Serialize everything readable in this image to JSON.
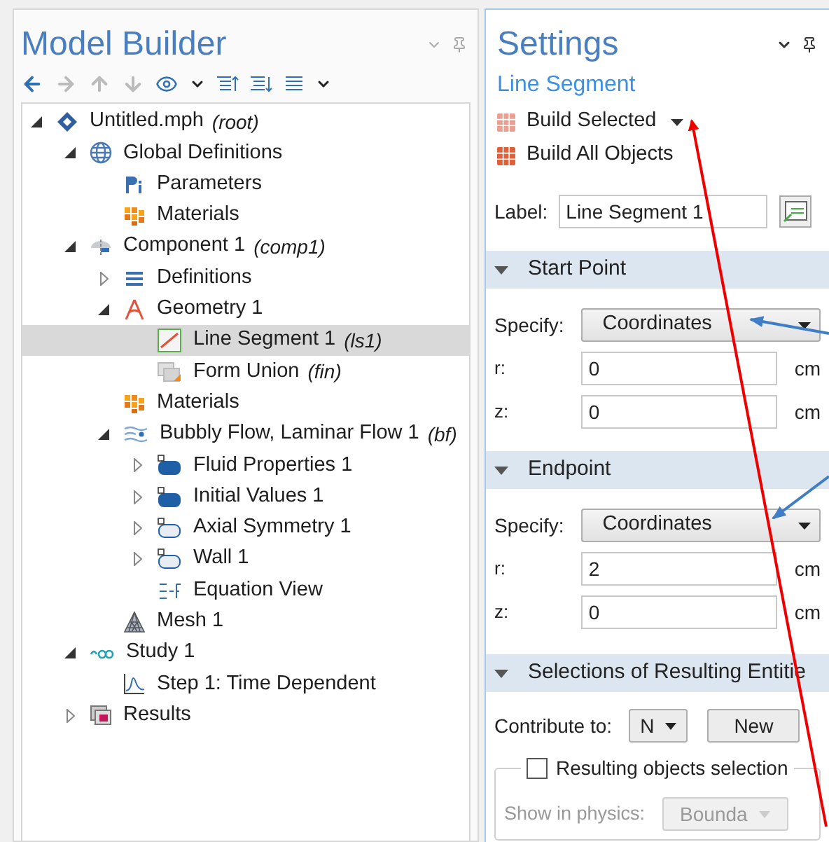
{
  "model_builder": {
    "title": "Model Builder",
    "tree": [
      {
        "kind": "root",
        "label": "Untitled.mph",
        "tag": "(root)",
        "expanded": true,
        "selected": false,
        "children": [
          {
            "kind": "globe",
            "label": "Global Definitions",
            "expanded": true,
            "selected": false,
            "children": [
              {
                "kind": "parameters",
                "label": "Parameters",
                "selected": false
              },
              {
                "kind": "materials",
                "label": "Materials",
                "selected": false
              }
            ]
          },
          {
            "kind": "component",
            "label": "Component 1",
            "tag": "(comp1)",
            "expanded": true,
            "selected": false,
            "children": [
              {
                "kind": "definitions",
                "label": "Definitions",
                "expanded": false,
                "selected": false
              },
              {
                "kind": "geometry",
                "label": "Geometry 1",
                "expanded": true,
                "selected": false,
                "children": [
                  {
                    "kind": "line",
                    "label": "Line Segment 1",
                    "tag": "(ls1)",
                    "selected": true
                  },
                  {
                    "kind": "union",
                    "label": "Form Union",
                    "tag": "(fin)",
                    "selected": false
                  }
                ]
              },
              {
                "kind": "materials",
                "label": "Materials",
                "selected": false
              },
              {
                "kind": "flow",
                "label": "Bubbly Flow, Laminar Flow 1",
                "tag": "(bf)",
                "expanded": true,
                "selected": false,
                "children": [
                  {
                    "kind": "domain",
                    "label": "Fluid Properties 1",
                    "expanded": false,
                    "selected": false
                  },
                  {
                    "kind": "domain",
                    "label": "Initial Values 1",
                    "expanded": false,
                    "selected": false
                  },
                  {
                    "kind": "boundary",
                    "label": "Axial Symmetry 1",
                    "expanded": false,
                    "selected": false
                  },
                  {
                    "kind": "boundary",
                    "label": "Wall 1",
                    "expanded": false,
                    "selected": false
                  },
                  {
                    "kind": "equation",
                    "label": "Equation View",
                    "selected": false
                  }
                ]
              },
              {
                "kind": "mesh",
                "label": "Mesh 1",
                "selected": false
              }
            ]
          },
          {
            "kind": "study",
            "label": "Study 1",
            "expanded": true,
            "selected": false,
            "children": [
              {
                "kind": "step",
                "label": "Step 1: Time Dependent",
                "selected": false
              }
            ]
          },
          {
            "kind": "results",
            "label": "Results",
            "expanded": false,
            "selected": false
          }
        ]
      }
    ]
  },
  "settings": {
    "title": "Settings",
    "subtitle": "Line Segment",
    "actions": [
      {
        "kind": "selected",
        "label": "Build Selected"
      },
      {
        "kind": "all",
        "label": "Build All Objects"
      }
    ],
    "label_field": {
      "label": "Label:",
      "value": "Line Segment 1"
    },
    "sections": [
      {
        "title": "Start Point",
        "expanded": true,
        "specify_label": "Specify:",
        "specify": "Coordinates",
        "fields": [
          {
            "label": "r:",
            "value": "0",
            "unit": "cm"
          },
          {
            "label": "z:",
            "value": "0",
            "unit": "cm"
          }
        ]
      },
      {
        "title": "Endpoint",
        "expanded": true,
        "specify_label": "Specify:",
        "specify": "Coordinates",
        "fields": [
          {
            "label": "r:",
            "value": "2",
            "unit": "cm"
          },
          {
            "label": "z:",
            "value": "0",
            "unit": "cm"
          }
        ]
      }
    ],
    "selections": {
      "title": "Selections of Resulting Entitie",
      "expanded": true,
      "contribute_label": "Contribute to:",
      "contribute_value": "N",
      "new_button": "New",
      "checkbox_label": "Resulting objects selection",
      "checked": false,
      "show_label": "Show in physics:",
      "show_value": "Bounda"
    }
  }
}
